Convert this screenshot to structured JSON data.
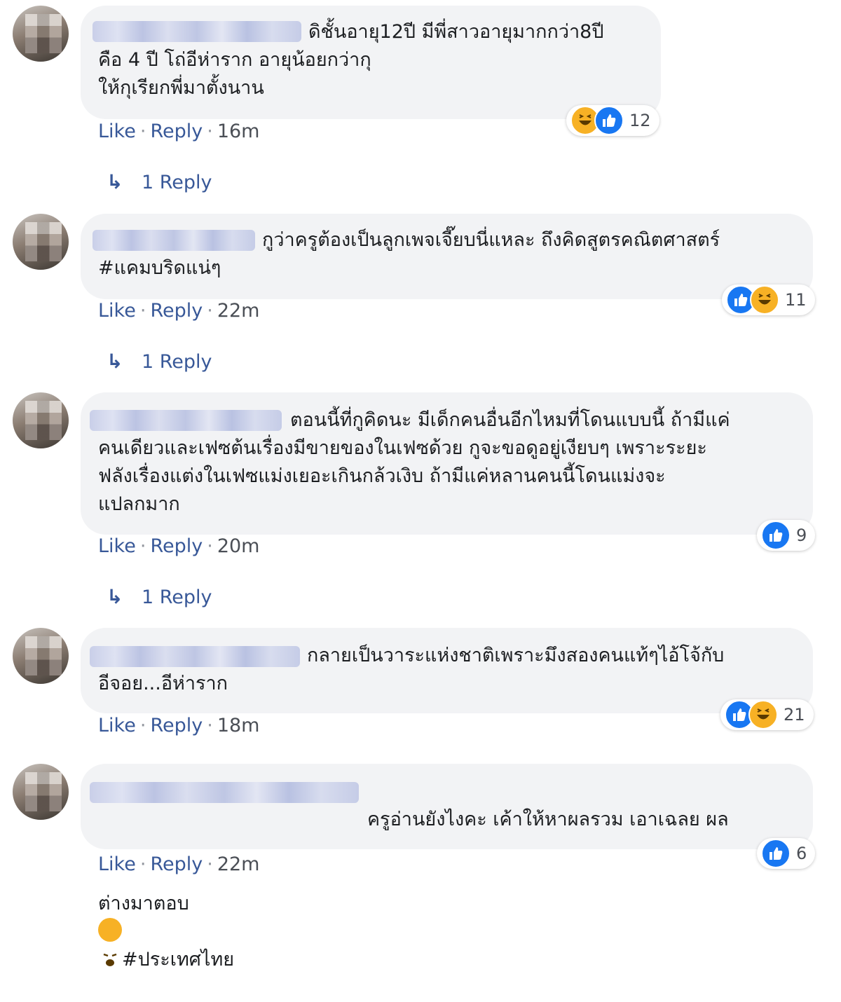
{
  "comments": [
    {
      "text": "ดิชั้นอายุ12ปี มีพี่สาวอายุมากกว่า8ปี\nคือ 4 ปี โถ่อีห่าราก อายุน้อยกว่ากุ\nให้กุเรียกพี่มาตั้งนาน",
      "like": "Like",
      "reply": "Reply",
      "time": "16m",
      "reactions": [
        "haha",
        "like"
      ],
      "reaction_count": "12",
      "replies_label": "1 Reply"
    },
    {
      "text": "กูว่าครูต้องเป็นลูกเพจเจี๊ยบนี่แหละ ถึงคิดสูตรคณิตศาสตร์\n#แคมบริดแน่ๆ",
      "like": "Like",
      "reply": "Reply",
      "time": "22m",
      "reactions": [
        "like",
        "haha"
      ],
      "reaction_count": "11",
      "replies_label": "1 Reply"
    },
    {
      "text": "ตอนนี้ที่กูคิดนะ มีเด็กคนอื่นอีกไหมที่โดนแบบนี้ ถ้ามีแค่\nคนเดียวและเฟซต้นเรื่องมีขายของในเฟซด้วย กูจะขอดูอยู่เงียบๆ เพราะระยะ\nฟลังเรื่องแต่งในเฟซแม่งเยอะเกินกล้วเงิบ ถ้ามีแค่หลานคนนี้โดนแม่งจะ\nแปลกมาก",
      "like": "Like",
      "reply": "Reply",
      "time": "20m",
      "reactions": [
        "like"
      ],
      "reaction_count": "9",
      "replies_label": "1 Reply"
    },
    {
      "text": "กลายเป็นวาระแห่งชาติเพราะมึงสองคนแท้ๆไอ้โจ้กับ\nอีจอย...อีห่าราก",
      "like": "Like",
      "reply": "Reply",
      "time": "18m",
      "reactions": [
        "like",
        "haha"
      ],
      "reaction_count": "21"
    },
    {
      "text_line1": "ครูอ่านยังไงคะ เค้าให้หาผลรวม เอาเฉลย ผล",
      "text_line2_a": "ต่างมาตอบ",
      "text_line2_b": "#ประเทศไทย",
      "like": "Like",
      "reply": "Reply",
      "time": "22m",
      "reactions": [
        "like"
      ],
      "reaction_count": "6"
    }
  ],
  "separator": "·",
  "icons": {
    "like": "like-reaction-icon",
    "haha": "haha-reaction-icon",
    "reply_arrow": "reply-arrow-icon",
    "inline": "tired-face-emoji-icon"
  },
  "colors": {
    "bubble": "#f2f3f5",
    "link": "#385898",
    "like_blue": "#1877f2",
    "haha_yellow": "#f7b125"
  }
}
